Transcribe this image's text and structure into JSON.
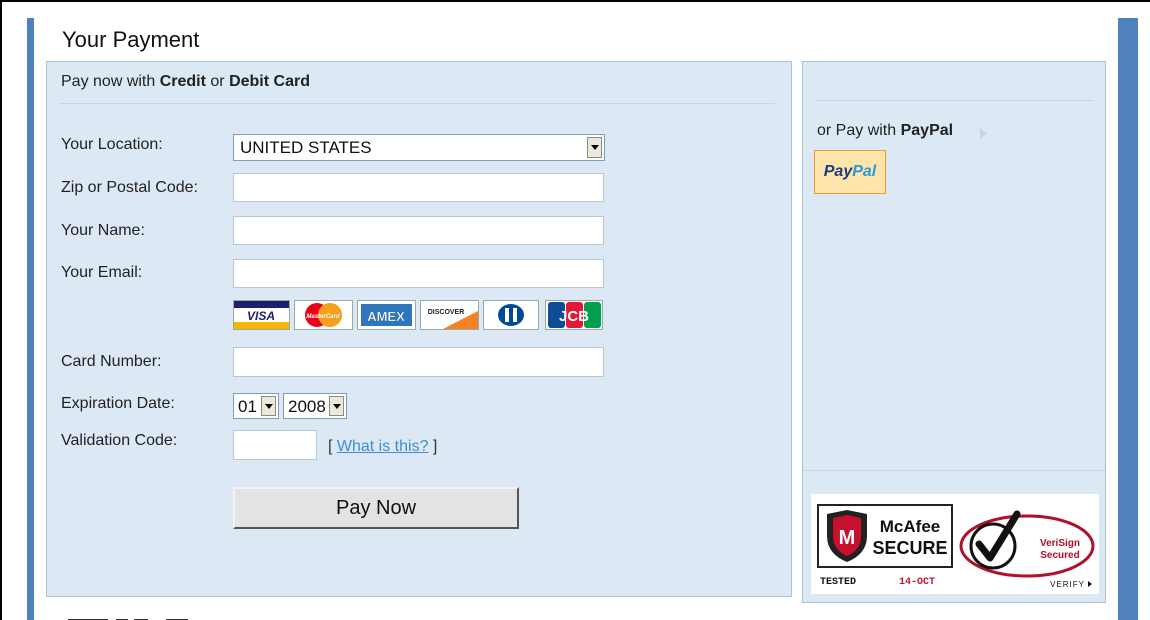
{
  "heading": "Your Payment",
  "card_section": {
    "intro_prefix": "Pay now with ",
    "intro_credit": "Credit",
    "intro_or": " or ",
    "intro_debit": "Debit Card"
  },
  "form": {
    "location_label": "Your Location:",
    "location_value": "UNITED STATES",
    "zip_label": "Zip or Postal Code:",
    "zip_value": "",
    "name_label": "Your Name:",
    "name_value": "",
    "email_label": "Your Email:",
    "email_value": "",
    "card_number_label": "Card Number:",
    "card_number_value": "",
    "expiration_label": "Expiration Date:",
    "exp_month": "01",
    "exp_year": "2008",
    "validation_label": "Validation Code:",
    "validation_value": "",
    "help_open": "[ ",
    "help_link": "What is this?",
    "help_close": " ]",
    "pay_button": "Pay Now"
  },
  "cards": [
    {
      "icon": "visa-card-icon",
      "text": "VISA",
      "color": "#1a1f71"
    },
    {
      "icon": "mastercard-icon",
      "text": "MasterCard",
      "color": "#eb001b"
    },
    {
      "icon": "amex-card-icon",
      "text": "AMEX",
      "color": "#2e77bc"
    },
    {
      "icon": "discover-card-icon",
      "text": "DISCOVER",
      "color": "#f58220"
    },
    {
      "icon": "diners-club-icon",
      "text": "",
      "color": "#004a97"
    },
    {
      "icon": "jcb-card-icon",
      "text": "JCB",
      "color": "#0e4c96"
    }
  ],
  "paypal_section": {
    "text_prefix": "or Pay with ",
    "text_bold": "PayPal",
    "logo_part1": "Pay",
    "logo_part2": "Pal"
  },
  "seals": {
    "mcafee_name": "McAfee",
    "mcafee_secure": "SECURE",
    "mcafee_tested": "TESTED",
    "mcafee_date": "14-OCT",
    "verisign_line1": "VeriSign",
    "verisign_line2": "Secured",
    "verisign_verify": "VERIFY"
  },
  "colors": {
    "panel_bg": "#dde8f5",
    "accent": "#4f81bd",
    "link": "#3c8fd1"
  }
}
